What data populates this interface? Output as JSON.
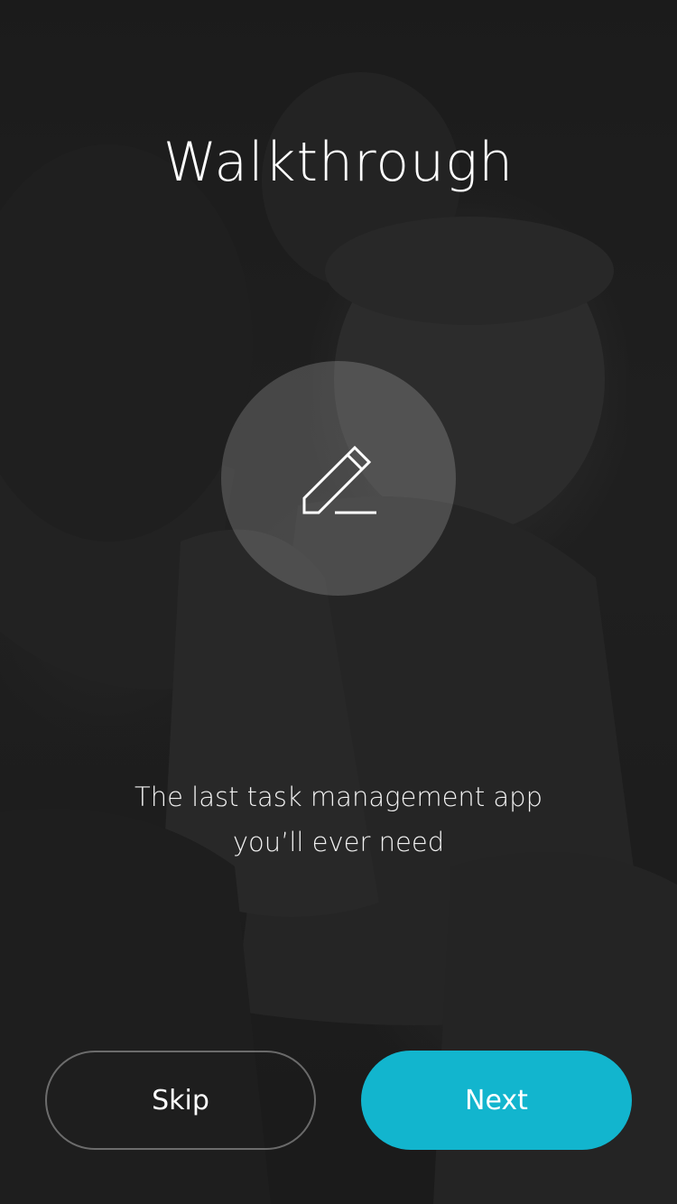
{
  "title": "Walkthrough",
  "feature_icon": "pencil-icon",
  "tagline": {
    "line1": "The last task management app",
    "line2": "you’ll ever need"
  },
  "buttons": {
    "skip_label": "Skip",
    "next_label": "Next"
  },
  "colors": {
    "accent": "#12B5CE",
    "text": "#FFFFFF"
  }
}
